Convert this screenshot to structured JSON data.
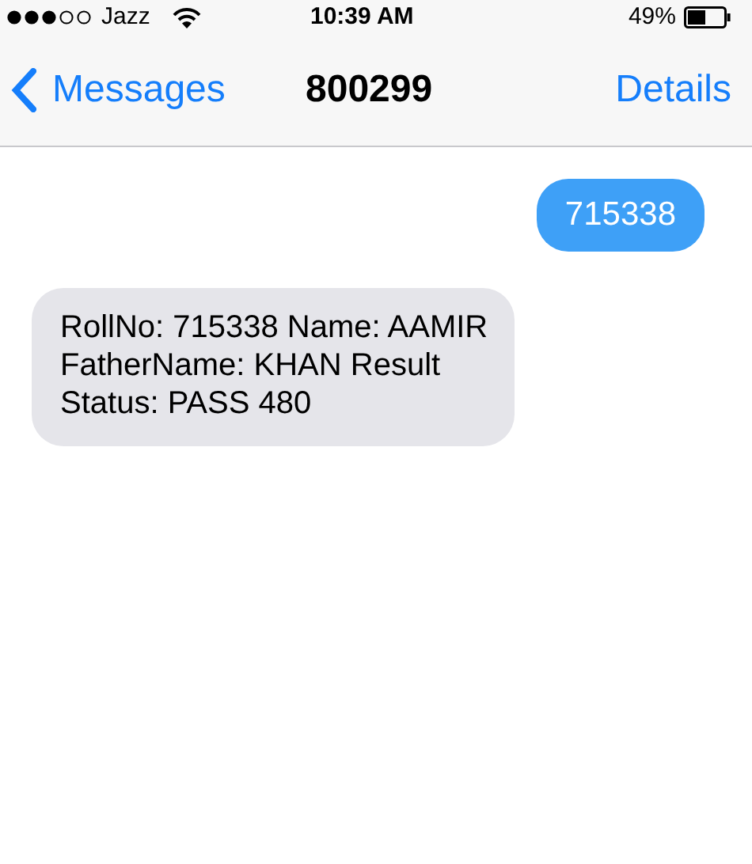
{
  "status_bar": {
    "carrier": "Jazz",
    "time": "10:39 AM",
    "battery": "49%"
  },
  "nav_bar": {
    "back": "Messages",
    "title": "800299",
    "action": "Details"
  },
  "messages": [
    {
      "kind": "sent",
      "text": "715338"
    },
    {
      "kind": "received",
      "text": "RollNo: 715338 Name: AAMIR FatherName: KHAN Result Status: PASS 480"
    }
  ]
}
